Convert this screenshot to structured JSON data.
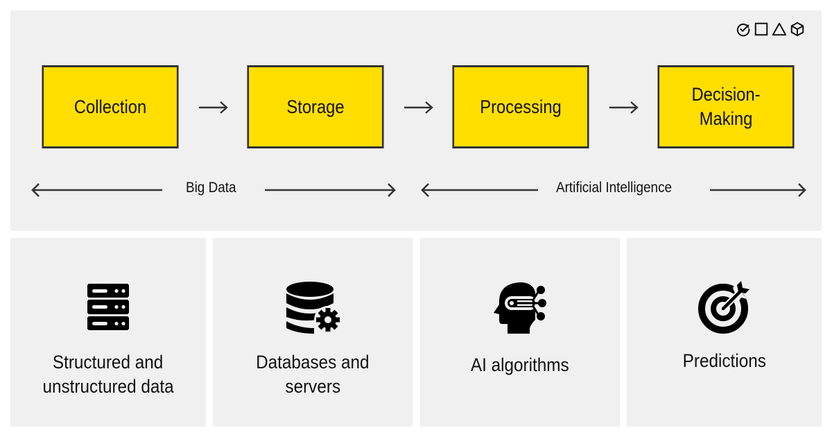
{
  "diagram": {
    "accent_color": "#ffde00",
    "border_color": "#333333",
    "panel_color": "#f0f0f0",
    "brand_icons": [
      "check-circle-icon",
      "square-icon",
      "triangle-icon",
      "cube-icon"
    ],
    "stages": [
      {
        "id": "collection",
        "lines": [
          "Collection"
        ]
      },
      {
        "id": "storage",
        "lines": [
          "Storage"
        ]
      },
      {
        "id": "processing",
        "lines": [
          "Processing"
        ]
      },
      {
        "id": "decision-making",
        "lines": [
          "Decision-",
          "Making"
        ]
      }
    ],
    "arrows": [
      "right-arrow",
      "right-arrow",
      "right-arrow"
    ],
    "spans": [
      {
        "label": "Big Data",
        "covers": [
          "Collection",
          "Storage"
        ]
      },
      {
        "label": "Artificial Intelligence",
        "covers": [
          "Processing",
          "Decision-Making"
        ]
      }
    ],
    "cards": [
      {
        "icon": "server-rack-icon",
        "lines": [
          "Structured and",
          "unstructured data"
        ]
      },
      {
        "icon": "database-gear-icon",
        "lines": [
          "Databases and",
          "servers"
        ]
      },
      {
        "icon": "ai-head-icon",
        "lines": [
          "AI algorithms"
        ]
      },
      {
        "icon": "target-arrow-icon",
        "lines": [
          "Predictions"
        ]
      }
    ]
  }
}
